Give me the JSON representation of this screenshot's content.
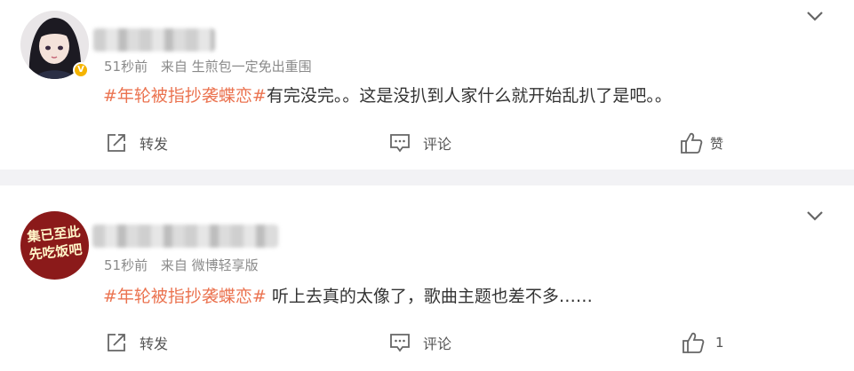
{
  "comments": [
    {
      "time": "51秒前",
      "source_prefix": "来自",
      "source": "生煎包一定免出重围",
      "topic": "#年轮被指抄袭蝶恋#",
      "text": "有完没完。。这是没扒到人家什么就开始乱扒了是吧。。",
      "verified": true,
      "actions": {
        "repost": "转发",
        "comment": "评论",
        "like": "赞"
      }
    },
    {
      "time": "51秒前",
      "source_prefix": "来自",
      "source": "微博轻享版",
      "topic": "#年轮被指抄袭蝶恋#",
      "text": " 听上去真的太像了，歌曲主题也差不多……",
      "verified": false,
      "actions": {
        "repost": "转发",
        "comment": "评论",
        "like_count": "1"
      }
    }
  ],
  "avatar2_text": [
    "集已至此",
    "先吃饭吧"
  ],
  "colors": {
    "topic": "#eb7350",
    "meta": "#8a8a8a",
    "badge": "#f5b400",
    "avatar2_bg": "#8b1a1a"
  },
  "icons": [
    "chevron-down-icon",
    "repost-icon",
    "comment-icon",
    "thumbs-up-icon",
    "verified-badge-icon"
  ]
}
